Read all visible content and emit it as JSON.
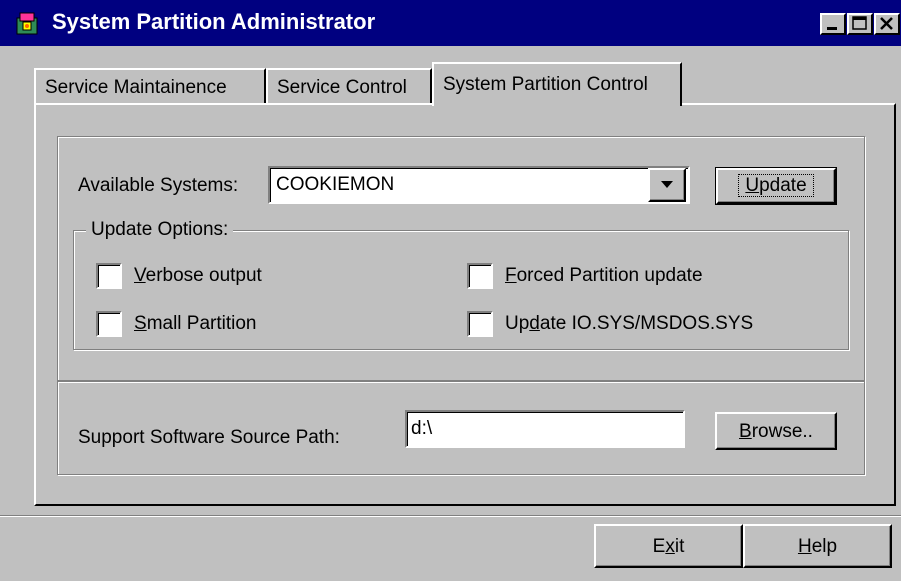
{
  "window": {
    "title": "System Partition Administrator",
    "titlebar_color": "#000080",
    "face_color": "#c0c0c0"
  },
  "tabs": [
    {
      "label": "Service Maintainence",
      "active": false
    },
    {
      "label": "Service Control",
      "active": false
    },
    {
      "label": "System Partition Control",
      "active": true
    }
  ],
  "available_systems": {
    "label": "Available Systems:",
    "value": "COOKIEMON",
    "update_button": {
      "pre": "",
      "key": "U",
      "post": "pdate"
    }
  },
  "update_options": {
    "legend": "Update Options:",
    "checkboxes": [
      {
        "pre": "",
        "key": "V",
        "post": "erbose output",
        "checked": false
      },
      {
        "pre": "",
        "key": "F",
        "post": "orced Partition update",
        "checked": false
      },
      {
        "pre": "",
        "key": "S",
        "post": "mall Partition",
        "checked": false
      },
      {
        "pre": "Up",
        "key": "d",
        "post": "ate IO.SYS/MSDOS.SYS",
        "checked": false
      }
    ]
  },
  "source_path": {
    "label": "Support Software Source Path:",
    "value": "d:\\",
    "browse_button": {
      "pre": "",
      "key": "B",
      "post": "rowse.."
    }
  },
  "footer": {
    "exit_button": {
      "pre": "E",
      "key": "x",
      "post": "it"
    },
    "help_button": {
      "pre": "",
      "key": "H",
      "post": "elp"
    }
  },
  "icons": {
    "app": "app-icon",
    "minimize": "minimize-icon",
    "maximize": "maximize-icon",
    "close": "close-icon",
    "dropdown": "dropdown-arrow-icon"
  }
}
